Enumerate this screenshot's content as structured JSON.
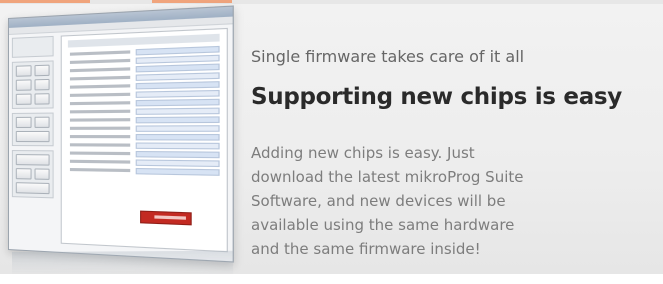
{
  "section": {
    "subtitle": "Single firmware takes care of it all",
    "title": "Supporting new chips is easy",
    "description_lines": [
      "Adding new chips is easy. Just",
      "download the latest mikroProg Suite",
      "Software, and new devices will be",
      "available using the same hardware",
      "and the same firmware inside!"
    ]
  },
  "colors": {
    "accent": "#f0a47c",
    "title_text": "#2a2a2a",
    "body_text": "#7d7d7d",
    "logo_red": "#c32a22"
  },
  "icons": [
    "software-screenshot-image",
    "mikroelektronika-logo-icon"
  ]
}
